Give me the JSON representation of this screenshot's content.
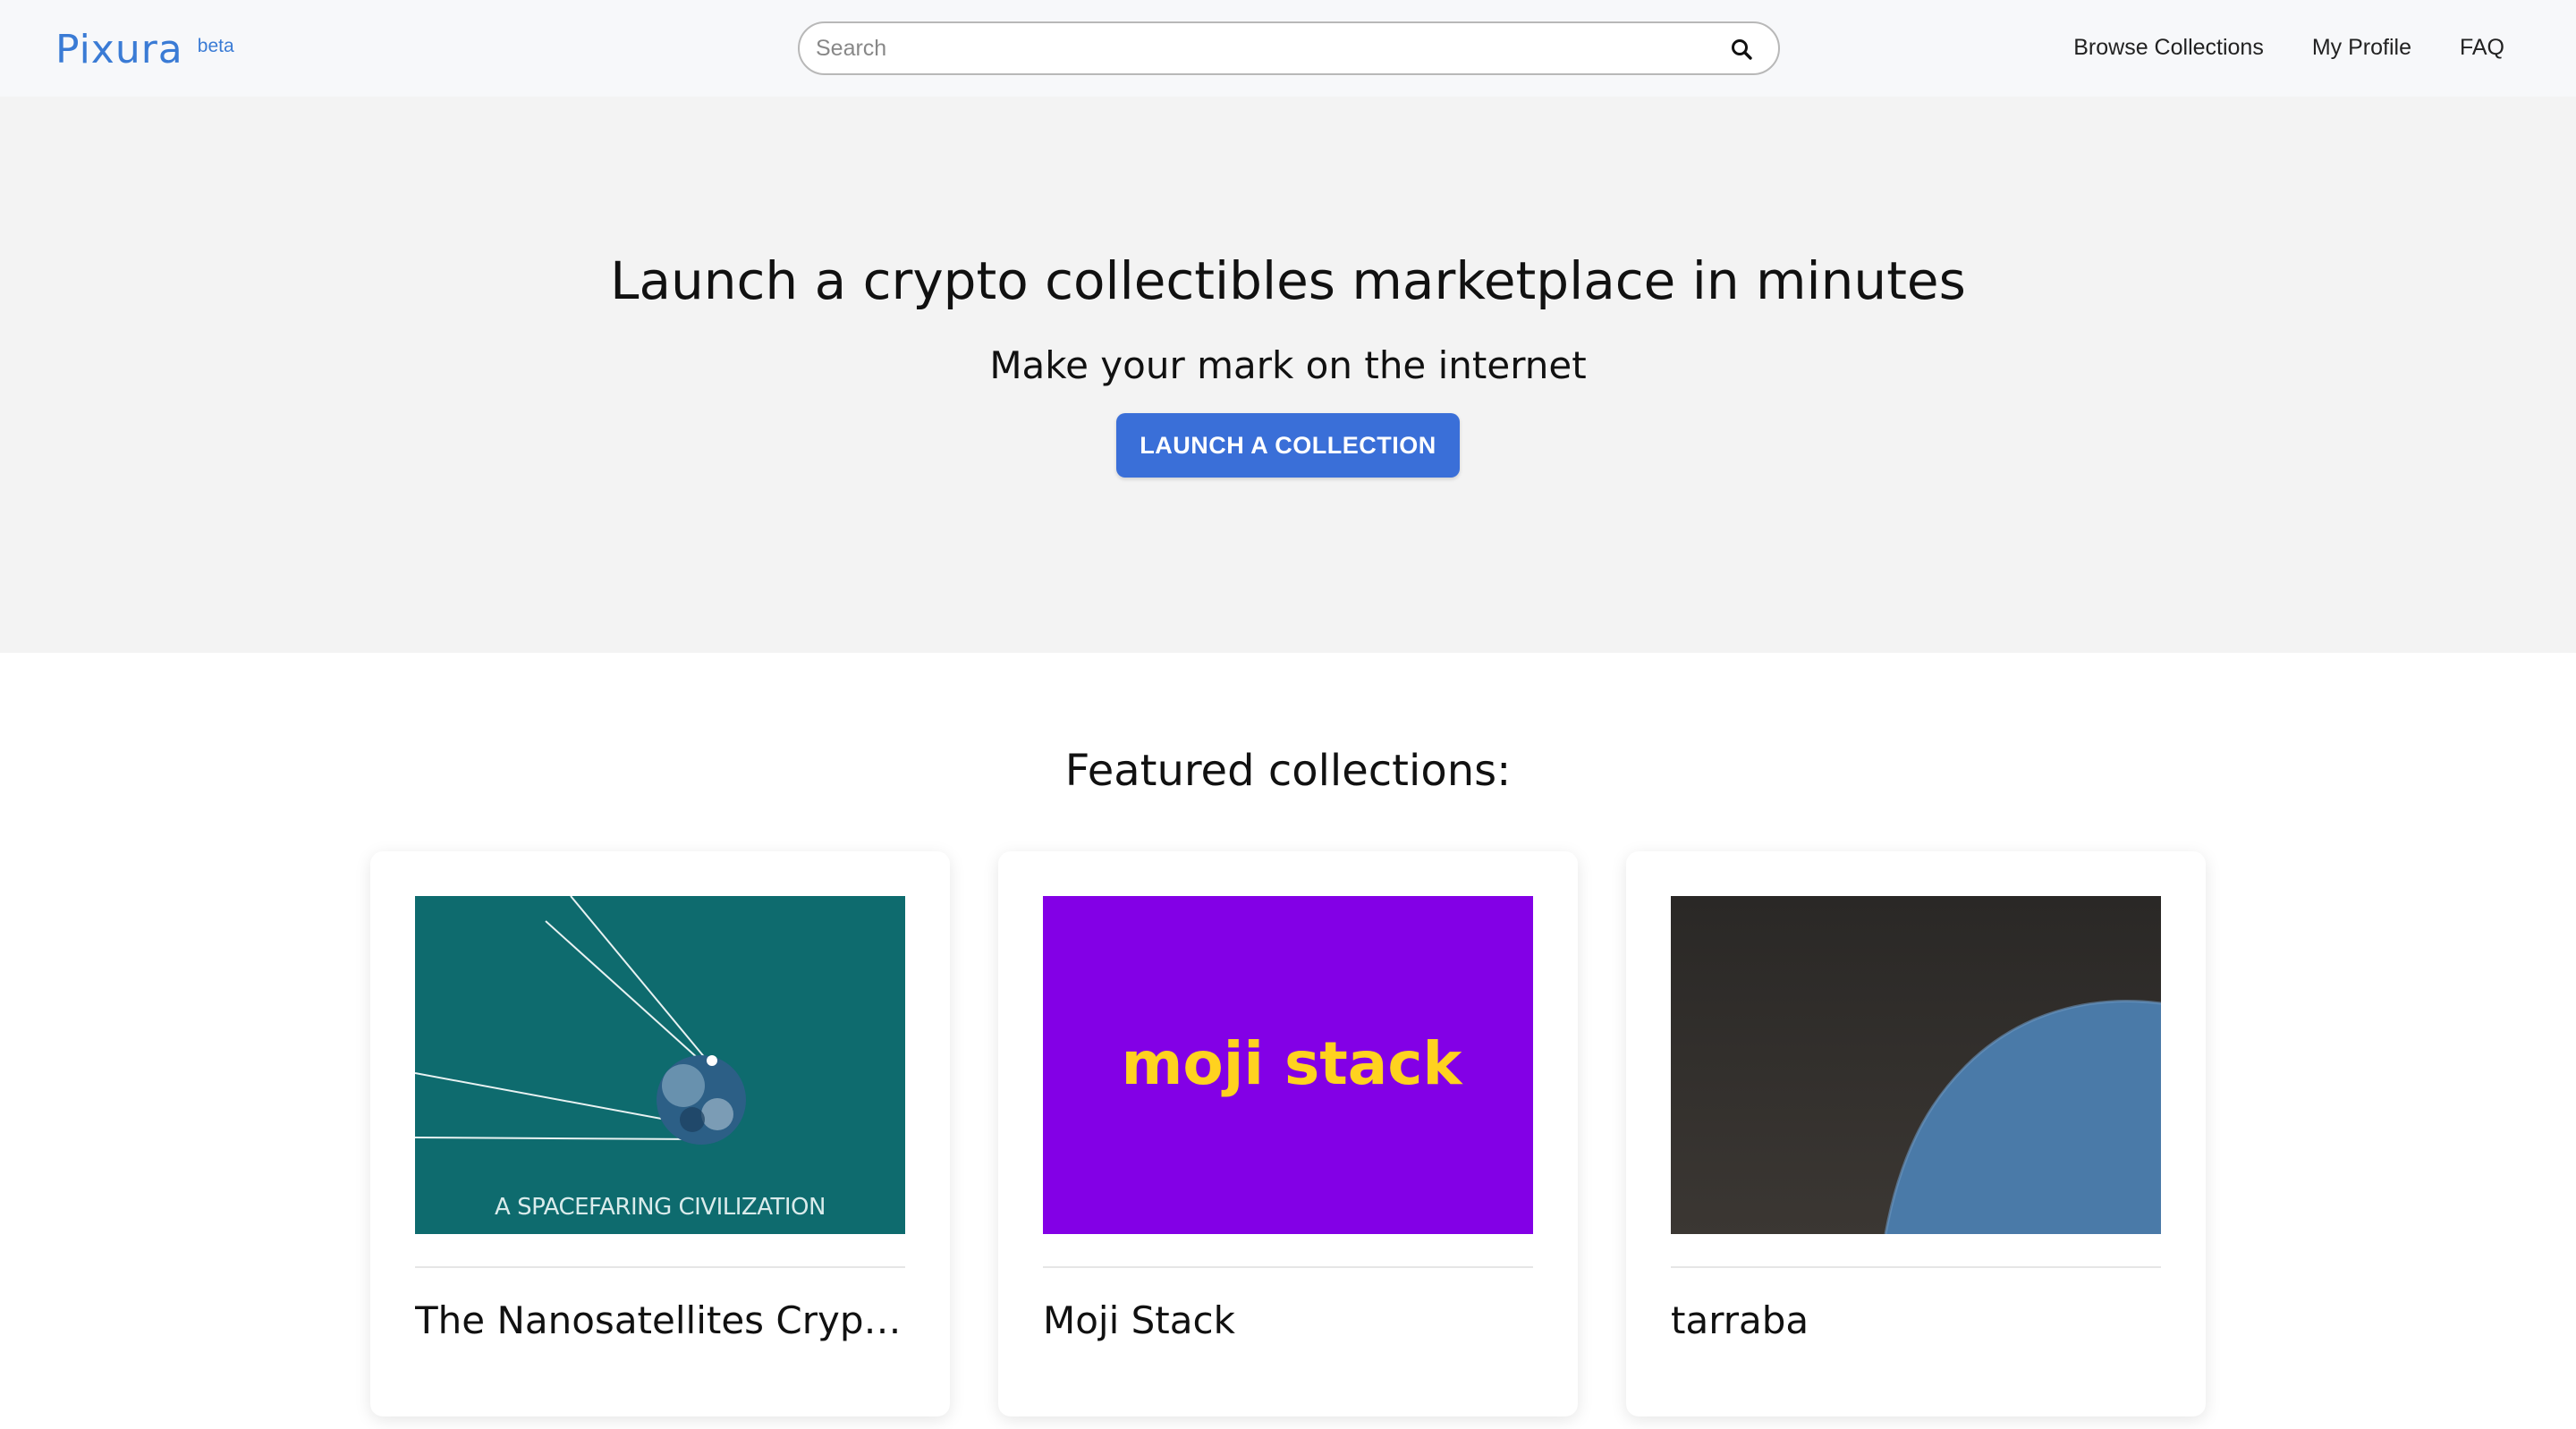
{
  "header": {
    "logo_text": "Pixura",
    "badge": "beta",
    "search_placeholder": "Search",
    "nav": [
      "Browse Collections",
      "My Profile",
      "FAQ"
    ]
  },
  "hero": {
    "title": "Launch a crypto collectibles marketplace in minutes",
    "subtitle": "Make your mark on the internet",
    "cta": "LAUNCH A COLLECTION"
  },
  "featured": {
    "title": "Featured collections:",
    "cards": [
      {
        "name": "The Nanosatellites Crypto…",
        "image_caption": "A SPACEFARING CIVILIZATION"
      },
      {
        "name": "Moji Stack",
        "image_caption": "moji stack"
      },
      {
        "name": "tarraba"
      }
    ]
  },
  "colors": {
    "brand": "#3a7bd5",
    "cta": "#3a6fd8",
    "card1_bg": "#0e6b6e",
    "card2_bg": "#8300e6",
    "card3_bg": "#2e2b28"
  }
}
